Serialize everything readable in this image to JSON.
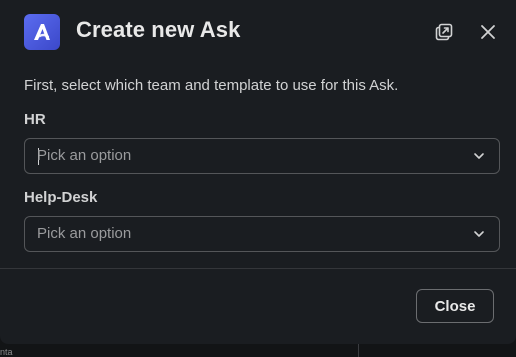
{
  "modal": {
    "title": "Create new Ask",
    "app_icon": "ask-app-logo",
    "popout_icon": "popout-icon",
    "close_icon": "close-icon",
    "intro": "First, select which team and template to use for this Ask.",
    "fields": [
      {
        "label": "HR",
        "placeholder": "Pick an option",
        "focused": true
      },
      {
        "label": "Help-Desk",
        "placeholder": "Pick an option",
        "focused": false
      }
    ],
    "footer": {
      "close_label": "Close"
    }
  },
  "colors": {
    "background": "#1a1d21",
    "logo_gradient_start": "#5b6cf0",
    "logo_gradient_end": "#3b48c9",
    "border": "#545659",
    "text": "#d1d2d3"
  },
  "backdrop": {
    "fragment_text": "nta"
  }
}
